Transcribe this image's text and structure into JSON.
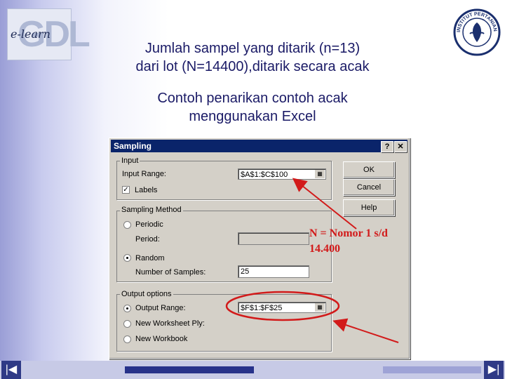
{
  "slide": {
    "title_line1": "Jumlah sampel yang ditarik (n=13)",
    "title_line2": "dari lot (N=14400),ditarik secara acak",
    "subtitle_line1": "Contoh penarikan contoh acak",
    "subtitle_line2": "menggunakan Excel",
    "annotation_line1": "N = Nomor 1 s/d",
    "annotation_line2": "14.400",
    "logo_left_text": "e-learn",
    "logo_left_letters": "GDL",
    "logo_right_text": "INSTITUT PERTANIAN BOGOR"
  },
  "dialog": {
    "title": "Sampling",
    "help_glyph": "?",
    "close_glyph": "✕",
    "input_group": "Input",
    "input_range_label": "Input Range:",
    "input_range_value": "$A$1:$C$100",
    "labels_label": "Labels",
    "labels_checked": true,
    "sampling_method_group": "Sampling Method",
    "periodic_label": "Periodic",
    "period_label": "Period:",
    "period_value": "",
    "random_label": "Random",
    "number_samples_label": "Number of Samples:",
    "number_samples_value": "25",
    "output_group": "Output options",
    "output_range_label": "Output Range:",
    "output_range_value": "$F$1:$F$25",
    "new_sheet_label": "New Worksheet Ply:",
    "new_workbook_label": "New Workbook",
    "ok_label": "OK",
    "cancel_label": "Cancel",
    "help_label": "Help"
  },
  "nav": {
    "first_glyph": "|◀",
    "last_glyph": "▶|"
  },
  "colors": {
    "annotation": "#d21a1a",
    "title_text": "#1a1a66",
    "dialog_titlebar": "#0a246a",
    "nav": "#2f3a86"
  }
}
